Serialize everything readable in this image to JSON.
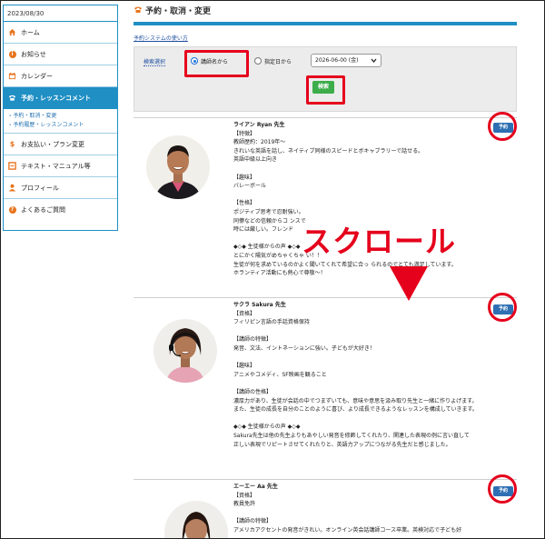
{
  "sidebar": {
    "date": "2023/08/30",
    "items": [
      {
        "label": "ホーム",
        "icon": "home-icon"
      },
      {
        "label": "お知らせ",
        "icon": "info-icon"
      },
      {
        "label": "カレンダー",
        "icon": "calendar-icon"
      },
      {
        "label": "予約・レッスンコメント",
        "icon": "phone-icon",
        "active": true
      },
      {
        "label": "お支払い・プラン変更",
        "icon": "dollar-icon"
      },
      {
        "label": "テキスト・マニュアル等",
        "icon": "document-icon"
      },
      {
        "label": "プロフィール",
        "icon": "person-icon"
      },
      {
        "label": "よくあるご質問",
        "icon": "question-icon"
      }
    ],
    "sub_items": [
      "予約・取消・変更",
      "予約履歴・レッスンコメント"
    ]
  },
  "page": {
    "title": "予約・取消・変更",
    "help_link": "予約システムの使い方"
  },
  "search": {
    "label": "検索選択",
    "option_teacher": "講師名から",
    "option_date": "指定日から",
    "date_value": "2026-06-00 (金)",
    "button": "検索"
  },
  "annotation": {
    "scroll_text": "スクロール"
  },
  "teachers": [
    {
      "reserve_label": "予約",
      "lines": [
        "ライアン Ryan 先生",
        "【特徴】",
        "教師歴約：2019年～",
        "きれいな英語を話し、ネイティブ同様のスピードとボキャブラリーで話せる。",
        "英語中級以上向き",
        "",
        "【趣味】",
        "バレーボール",
        "",
        "【性格】",
        "ポジティブ思考で忍耐強い。",
        "同僚などの信頼からコ                     ンスで",
        "時には厳しい。フレンド",
        "",
        "◆◇◆ 生徒様からの声 ◆◇◆",
        "とにかく陽気がめちゃくちゃ                                    い！！",
        "生徒が何を求めているのかよく聞いてくれて希望に合っ                        られるのでとても満足しています。",
        "ホランティア活動にも熱心で尊敬～！"
      ]
    },
    {
      "reserve_label": "予約",
      "lines": [
        "サクラ Sakura 先生",
        "【資格】",
        "フィリピン言語の手話資格保持",
        "",
        "【講師の特徴】",
        "発音、文法、イントネーションに強い。子どもが大好き！",
        "",
        "【趣味】",
        "アニメやコメディ、SF映画を観ること",
        "",
        "【講師の性格】",
        "濃厚力があり、生徒が会話の中でつまずいても、意味や意思を汲み取り先生と一緒に作りよげます。",
        "また、生徒の成長を自分のことのように喜び、より成長できるようなレッスンを構成していきます。",
        "",
        "◆◇◆ 生徒様からの声 ◆◇◆",
        "Sakura先生は他の先生よりもあやしい発音を修飾してくれたり、関連した表現の例に言い直して",
        "正しい表現でリピートさせてくれたりと、英語力アップにつながる先生だと感じました。"
      ]
    },
    {
      "reserve_label": "予約",
      "lines": [
        "エーエー Aa 先生",
        "【資格】",
        "教員免許",
        "",
        "【講師の特徴】",
        "アメリカアクセントの発音がきれい。オンライン英会話講師コース卒業。英検対応で子ども好"
      ]
    }
  ]
}
